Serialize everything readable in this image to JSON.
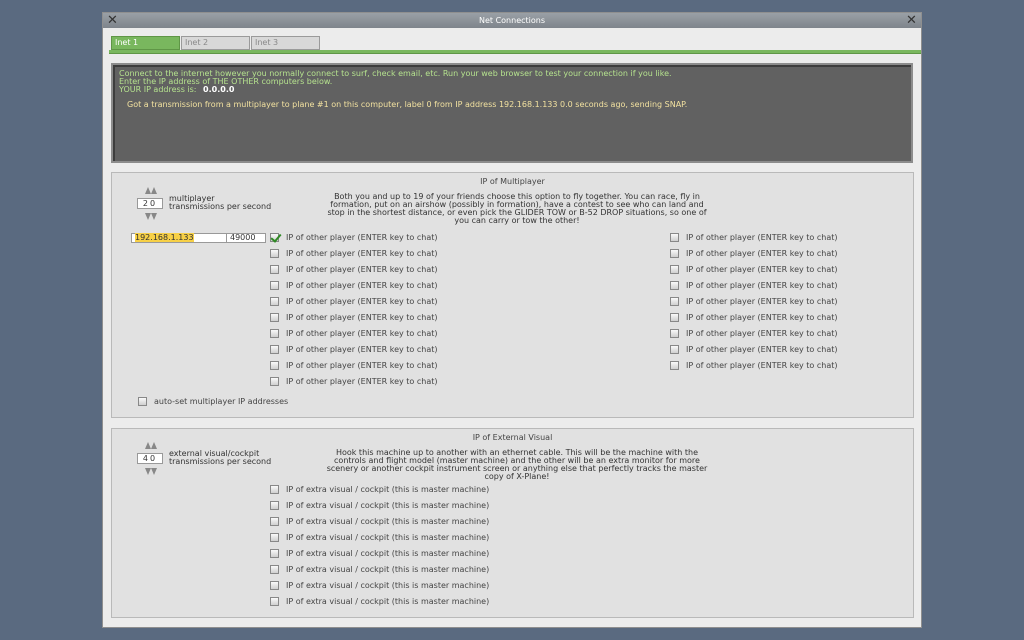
{
  "window": {
    "title": "Net Connections"
  },
  "tabs": [
    "Inet 1",
    "Inet 2",
    "Inet 3"
  ],
  "console": {
    "line1": "Connect to the internet however you normally connect to surf, check email, etc. Run your web browser to test your connection if you like.",
    "line2": "Enter the IP address of THE OTHER computers below.",
    "ip_label": "YOUR IP address is:",
    "ip_value": "0.0.0.0",
    "message": "Got a transmission from a multiplayer to plane #1 on this computer, label 0 from IP address 192.168.1.133  0.0 seconds ago, sending SNAP."
  },
  "multiplayer": {
    "title": "IP of Multiplayer",
    "rate_value": "20",
    "rate_label_1": "multiplayer",
    "rate_label_2": "transmissions per second",
    "desc_1": "Both you and up to 19 of your friends choose this option to fly together. You can race, fly in",
    "desc_2": "formation, put on an airshow (possibly in formation), have a contest to see who can land and",
    "desc_3": "stop in the shortest distance, or even pick the GLIDER TOW or B-52 DROP situations, so one of",
    "desc_4": "you can carry or tow the other!",
    "first_ip": "192.168.1.133",
    "first_port": "49000",
    "player_label": "IP of other player (ENTER key to chat)",
    "auto_set_label": "auto-set multiplayer IP addresses"
  },
  "external": {
    "title": "IP of External Visual",
    "rate_value": "40",
    "rate_label_1": "external visual/cockpit",
    "rate_label_2": "transmissions per second",
    "desc_1": "Hook this machine up to another with an ethernet cable. This will be the machine with the",
    "desc_2": "controls and flight model (master machine) and the other will be an extra monitor for more",
    "desc_3": "scenery or another cockpit instrument screen or anything else that perfectly tracks the master",
    "desc_4": "copy of X-Plane!",
    "visual_label": "IP of extra visual / cockpit (this is master machine)"
  },
  "icons": {
    "close": "close-icon",
    "spinner": "spinner-arrows-icon",
    "check": "checkmark-icon"
  },
  "colors": {
    "accent": "#79b75e",
    "console_bg": "#616161",
    "console_text": "#b5e28e",
    "console_msg": "#f2e1a0",
    "highlight": "#f7d046"
  }
}
